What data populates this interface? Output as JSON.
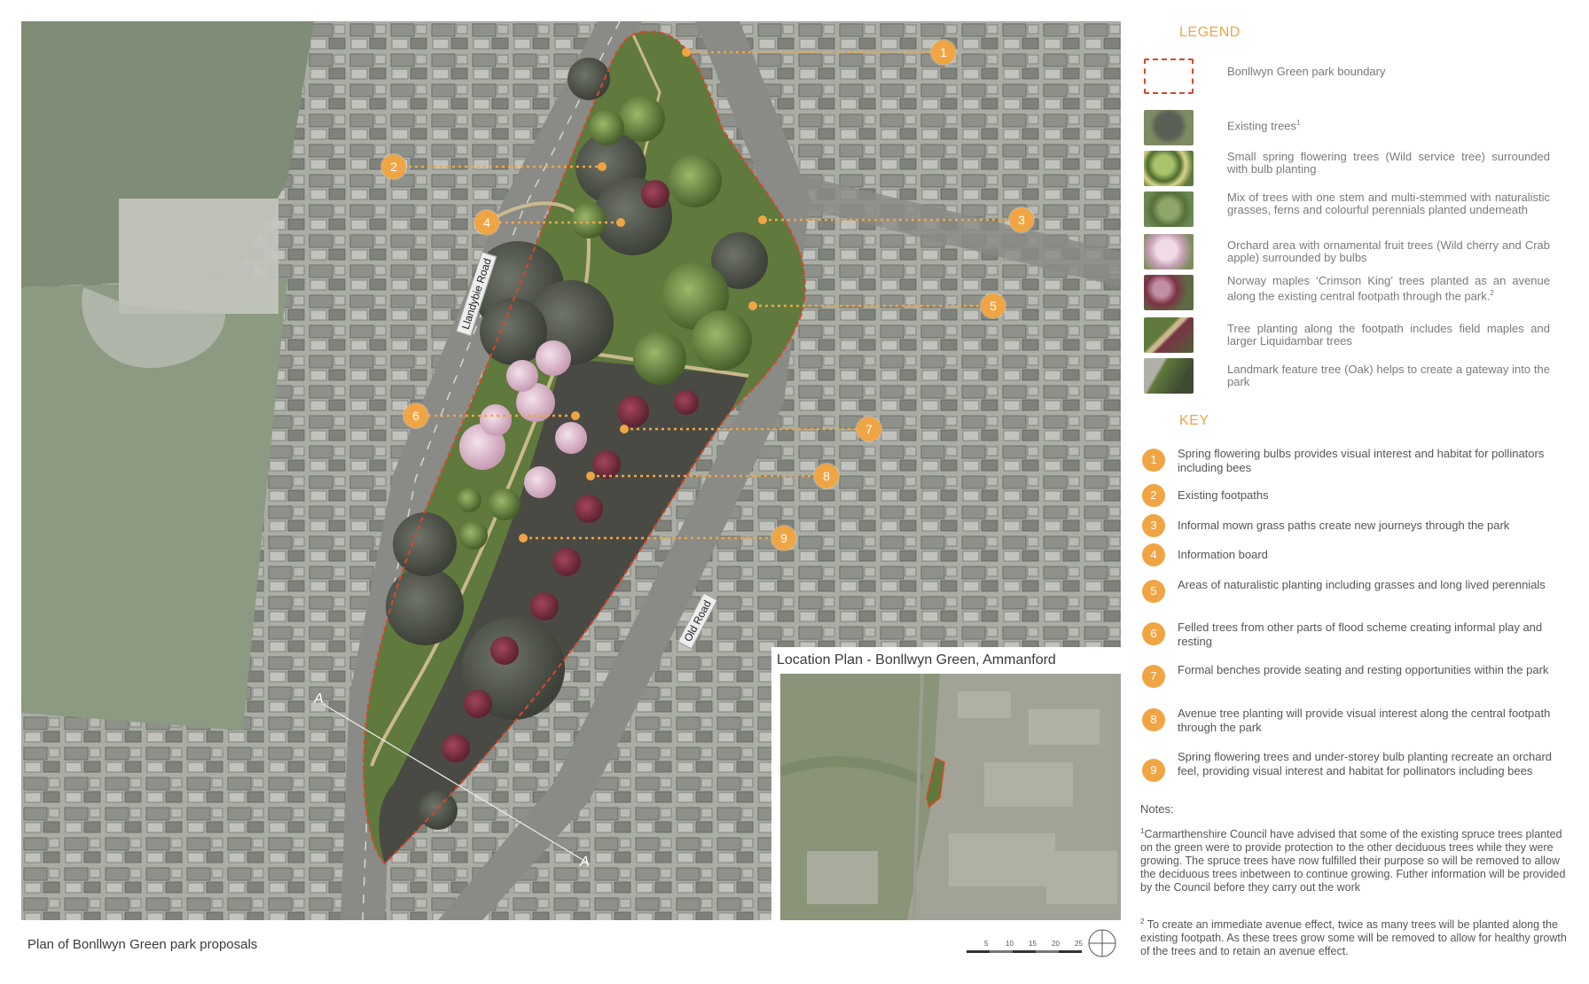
{
  "map_caption": "Plan of Bonllwyn Green park proposals",
  "road_labels": {
    "llandybie": "Llandybie Road",
    "old_road": "Old Road"
  },
  "section_markers": {
    "top": "A",
    "bottom": "A"
  },
  "callouts": [
    "1",
    "2",
    "3",
    "4",
    "5",
    "6",
    "7",
    "8",
    "9"
  ],
  "scale_labels": [
    "5",
    "10",
    "15",
    "20",
    "25"
  ],
  "location_plan": {
    "title": "Location Plan - Bonllwyn Green, Ammanford"
  },
  "legend": {
    "title": "LEGEND",
    "items": [
      {
        "label": "Bonllwyn Green park boundary",
        "sup": ""
      },
      {
        "label": "Existing trees",
        "sup": "1"
      },
      {
        "label": "Small spring flowering trees (Wild service tree) surrounded with bulb planting",
        "sup": ""
      },
      {
        "label": "Mix of trees with one stem and multi-stemmed with naturalistic grasses, ferns and colourful perennials planted underneath",
        "sup": ""
      },
      {
        "label": "Orchard area with ornamental fruit trees (Wild cherry and Crab apple) surrounded by bulbs",
        "sup": ""
      },
      {
        "label": "Norway maples ‘Crimson King’ trees planted as an avenue along the existing central footpath through the park.",
        "sup": "2"
      },
      {
        "label": "Tree planting along the footpath includes field maples and larger Liquidambar trees",
        "sup": ""
      },
      {
        "label": "Landmark feature tree (Oak) helps to create a gateway into the park",
        "sup": ""
      }
    ]
  },
  "key": {
    "title": "KEY",
    "items": [
      {
        "num": "1",
        "text": "Spring flowering bulbs provides visual interest and habitat for pollinators including bees"
      },
      {
        "num": "2",
        "text": "Existing footpaths"
      },
      {
        "num": "3",
        "text": "Informal mown grass paths create new journeys through the park"
      },
      {
        "num": "4",
        "text": "Information board"
      },
      {
        "num": "5",
        "text": "Areas of naturalistic planting including grasses and long lived perennials"
      },
      {
        "num": "6",
        "text": "Felled trees from other parts of flood scheme creating informal play and resting"
      },
      {
        "num": "7",
        "text": "Formal benches provide seating and resting opportunities within the park"
      },
      {
        "num": "8",
        "text": "Avenue tree planting will provide visual interest along the central footpath through the park"
      },
      {
        "num": "9",
        "text": "Spring flowering trees and under-storey bulb planting recreate an orchard feel, providing visual interest and habitat for pollinators including bees"
      }
    ]
  },
  "notes": {
    "title": "Notes:",
    "note1_sup": "1",
    "note1": "Carmarthenshire Council have advised that some of the existing spruce trees planted on the green were to provide protection to the other deciduous trees while they were growing. The spruce trees have now fulfilled their purpose so will be removed to allow the deciduous trees inbetween to continue growing. Futher information will be provided by the Council before they carry out the work",
    "note2_sup": "2",
    "note2": "To create an immediate avenue effect, twice as many trees will be planted along the existing footpath. As these trees grow some will be removed to allow for healthy growth of the trees and to retain an avenue effect."
  },
  "colors": {
    "accent": "#f0a545",
    "boundary": "#d9472b",
    "park_grass": "#5f7a3c",
    "mown_grass": "#4a4a44"
  }
}
